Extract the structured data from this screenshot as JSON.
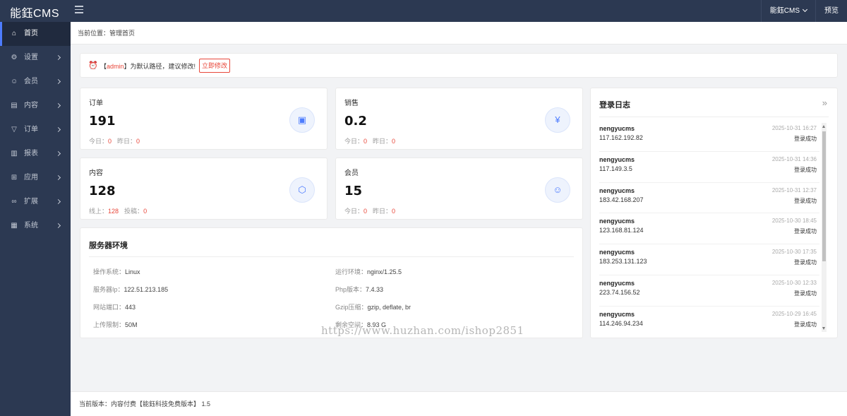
{
  "app": {
    "logo": "能鈺CMS"
  },
  "header": {
    "user_menu": "能鈺CMS",
    "preview": "预览"
  },
  "sidebar": {
    "items": [
      {
        "label": "首页",
        "icon": "home-icon"
      },
      {
        "label": "设置",
        "icon": "gear-icon"
      },
      {
        "label": "会员",
        "icon": "user-icon"
      },
      {
        "label": "内容",
        "icon": "layout-icon"
      },
      {
        "label": "订单",
        "icon": "filter-icon"
      },
      {
        "label": "报表",
        "icon": "bar-chart-icon"
      },
      {
        "label": "应用",
        "icon": "apps-icon"
      },
      {
        "label": "扩展",
        "icon": "link-icon"
      },
      {
        "label": "系统",
        "icon": "system-icon"
      }
    ]
  },
  "breadcrumb": "当前位置：管理首页",
  "alert": {
    "prefix": "【",
    "highlight": "admin",
    "suffix": "】为默认路径，建议修改!",
    "button": "立即修改"
  },
  "stats": {
    "orders": {
      "title": "订单",
      "value": "191",
      "l1": "今日：",
      "v1": "0",
      "l2": "昨日：",
      "v2": "0"
    },
    "sales": {
      "title": "销售",
      "value": "0.2",
      "l1": "今日：",
      "v1": "0",
      "l2": "昨日：",
      "v2": "0"
    },
    "content": {
      "title": "内容",
      "value": "128",
      "l1": "线上：",
      "v1": "128",
      "l2": "投稿：",
      "v2": "0"
    },
    "members": {
      "title": "会员",
      "value": "15",
      "l1": "今日：",
      "v1": "0",
      "l2": "昨日：",
      "v2": "0"
    }
  },
  "server": {
    "title": "服务器环境",
    "os_k": "操作系统：",
    "os_v": "Linux",
    "runtime_k": "运行环境：",
    "runtime_v": "nginx/1.25.5",
    "ip_k": "服务器Ip：",
    "ip_v": "122.51.213.185",
    "php_k": "Php版本：",
    "php_v": "7.4.33",
    "port_k": "网站端口：",
    "port_v": "443",
    "gzip_k": "Gzip压缩：",
    "gzip_v": "gzip, deflate, br",
    "upload_k": "上传限制：",
    "upload_v": "50M",
    "space_k": "剩余空间：",
    "space_v": "8.93 G"
  },
  "login_log": {
    "title": "登录日志",
    "entries": [
      {
        "user": "nengyucms",
        "ip": "117.162.192.82",
        "time": "2025-10-31 16:27",
        "status": "登录成功"
      },
      {
        "user": "nengyucms",
        "ip": "117.149.3.5",
        "time": "2025-10-31 14:36",
        "status": "登录成功"
      },
      {
        "user": "nengyucms",
        "ip": "183.42.168.207",
        "time": "2025-10-31 12:37",
        "status": "登录成功"
      },
      {
        "user": "nengyucms",
        "ip": "123.168.81.124",
        "time": "2025-10-30 18:45",
        "status": "登录成功"
      },
      {
        "user": "nengyucms",
        "ip": "183.253.131.123",
        "time": "2025-10-30 17:35",
        "status": "登录成功"
      },
      {
        "user": "nengyucms",
        "ip": "223.74.156.52",
        "time": "2025-10-30 12:33",
        "status": "登录成功"
      },
      {
        "user": "nengyucms",
        "ip": "114.246.94.234",
        "time": "2025-10-29 16:45",
        "status": "登录成功"
      }
    ]
  },
  "watermark": "https://www.huzhan.com/ishop2851",
  "footer": "当前版本：内容付费【能鈺科技免费版本】 1.5",
  "colors": {
    "sidebar": "#2c3952",
    "accent": "#4d7cfe",
    "danger": "#e8473a"
  }
}
